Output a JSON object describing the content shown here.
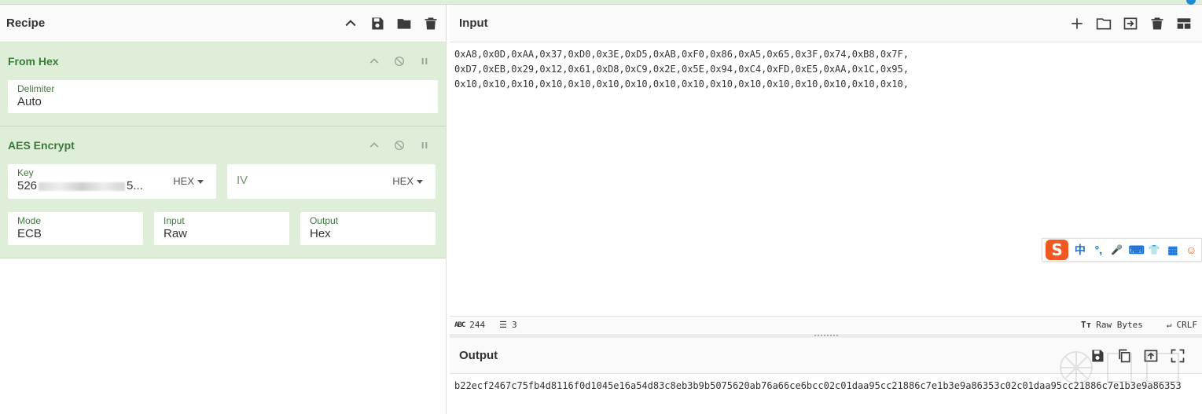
{
  "recipe": {
    "title": "Recipe",
    "ops": [
      {
        "name": "From Hex",
        "fields": {
          "delimiter_label": "Delimiter",
          "delimiter_value": "Auto"
        }
      },
      {
        "name": "AES Encrypt",
        "key_label": "Key",
        "key_value_start": "526",
        "key_value_end": "5...",
        "key_format": "HEX",
        "iv_label": "IV",
        "iv_format": "HEX",
        "mode_label": "Mode",
        "mode_value": "ECB",
        "input_label": "Input",
        "input_value": "Raw",
        "output_label": "Output",
        "output_value": "Hex"
      }
    ]
  },
  "input": {
    "title": "Input",
    "lines": [
      "0xA8,0x0D,0xAA,0x37,0xD0,0x3E,0xD5,0xAB,0xF0,0x86,0xA5,0x65,0x3F,0x74,0xB8,0x7F,",
      "0xD7,0xEB,0x29,0x12,0x61,0xD8,0xC9,0x2E,0x5E,0x94,0xC4,0xFD,0xE5,0xAA,0x1C,0x95,",
      "0x10,0x10,0x10,0x10,0x10,0x10,0x10,0x10,0x10,0x10,0x10,0x10,0x10,0x10,0x10,0x10,"
    ]
  },
  "status": {
    "abc_label": "ABC",
    "chars": "244",
    "lines": "3",
    "raw_bytes": "Raw Bytes",
    "eol": "CRLF"
  },
  "output": {
    "title": "Output",
    "text": "b22ecf2467c75fb4d8116f0d1045e16a54d83c8eb3b9b5075620ab76a66ce6bcc02c01daa95cc21886c7e1b3e9a86353c02c01daa95cc21886c7e1b3e9a86353"
  },
  "ime": {
    "logo": "S",
    "items": [
      "中",
      "°,",
      "🎤",
      "⌨",
      "👕",
      "▦",
      "☺"
    ]
  },
  "colors": {
    "op_bg": "#dfeed9",
    "op_label": "#3c7a3a",
    "ime_brand": "#f05a22",
    "ime_icon": "#1a6fd1"
  }
}
